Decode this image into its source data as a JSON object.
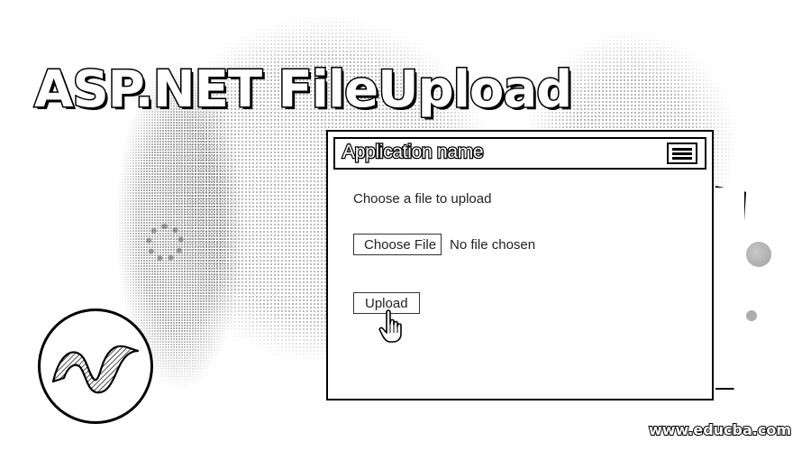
{
  "hero": {
    "title": "ASP.NET FileUpload"
  },
  "app": {
    "navbar": {
      "title": "Application name",
      "menu_icon": "hamburger-menu-icon"
    },
    "form": {
      "label": "Choose a file to upload",
      "choose_file_label": "Choose File",
      "no_file_text": "No file chosen",
      "upload_label": "Upload"
    },
    "cursor_icon": "hand-pointer-icon"
  },
  "logo": {
    "icon": "dotnet-logo-icon"
  },
  "footer": {
    "watermark": "www.educba.com"
  }
}
